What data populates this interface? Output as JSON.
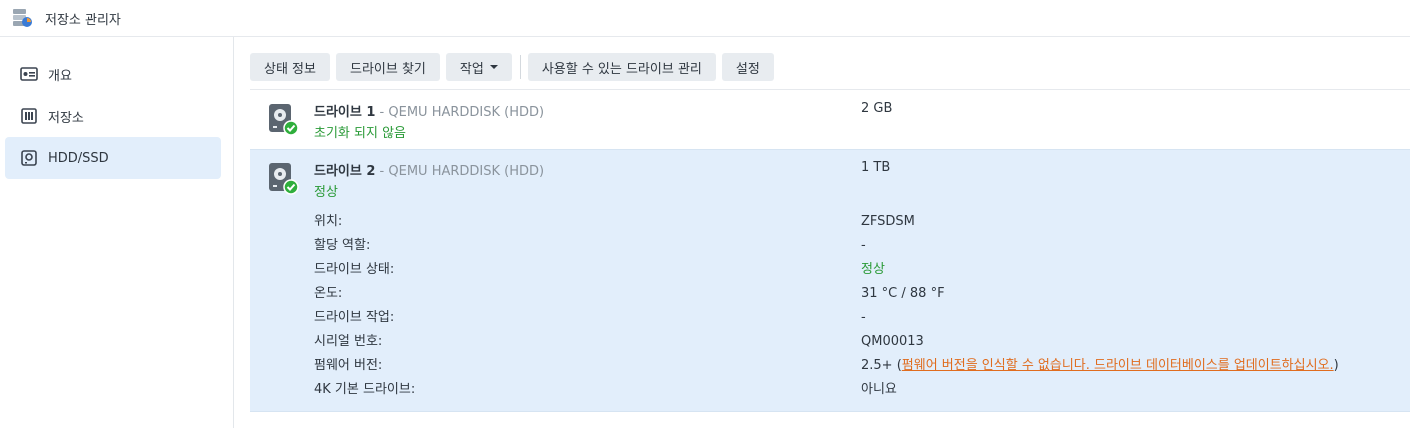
{
  "app": {
    "title": "저장소 관리자"
  },
  "sidebar": {
    "items": [
      {
        "label": "개요",
        "icon": "overview-icon",
        "active": false
      },
      {
        "label": "저장소",
        "icon": "storage-icon",
        "active": false
      },
      {
        "label": "HDD/SSD",
        "icon": "hdd-icon",
        "active": true
      }
    ]
  },
  "toolbar": {
    "status_info": "상태 정보",
    "find_drive": "드라이브 찾기",
    "action": "작업",
    "manage_available": "사용할 수 있는 드라이브 관리",
    "settings": "설정"
  },
  "drives": [
    {
      "name": "드라이브 1",
      "model": " - QEMU HARDDISK (HDD)",
      "status": "초기화 되지 않음",
      "size": "2 GB"
    },
    {
      "name": "드라이브 2",
      "model": " - QEMU HARDDISK (HDD)",
      "status": "정상",
      "size": "1 TB"
    }
  ],
  "details": {
    "location_label": "위치:",
    "location_value": "ZFSDSM",
    "role_label": "할당 역할:",
    "role_value": "-",
    "drive_status_label": "드라이브 상태:",
    "drive_status_value": "정상",
    "temp_label": "온도:",
    "temp_value": "31 °C / 88 °F",
    "task_label": "드라이브 작업:",
    "task_value": "-",
    "serial_label": "시리얼 번호:",
    "serial_value": "QM00013",
    "firmware_label": "펌웨어 버전:",
    "firmware_prefix": "2.5+ (",
    "firmware_link": "펌웨어 버전을 인식할 수 없습니다. 드라이브 데이터베이스를 업데이트하십시오.",
    "firmware_suffix": ")",
    "native4k_label": "4K 기본 드라이브:",
    "native4k_value": "아니요"
  },
  "colors": {
    "ok_green": "#2a9a37",
    "warning_link": "#e06c1e",
    "selected_bg": "#e2eefb"
  }
}
